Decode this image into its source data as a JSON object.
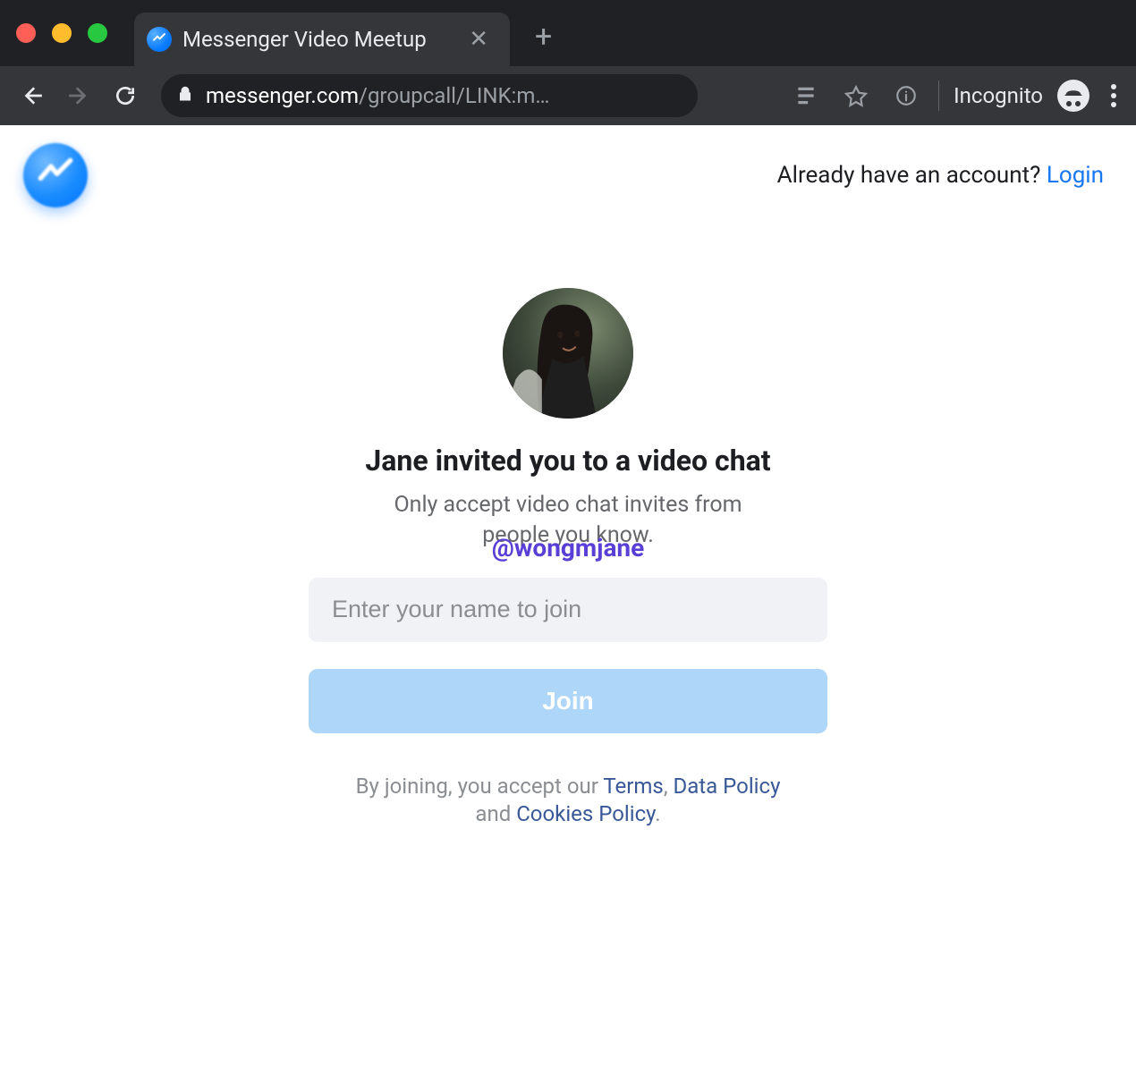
{
  "browser": {
    "tab_title": "Messenger Video Meetup",
    "url_host": "messenger.com",
    "url_path": "/groupcall/LINK:m…",
    "incognito_label": "Incognito"
  },
  "header": {
    "already_have": "Already have an account? ",
    "login": "Login"
  },
  "main": {
    "invite_heading": "Jane invited you to a video chat",
    "subtext": "Only accept video chat invites from people you know.",
    "watermark": "@wongmjane",
    "name_placeholder": "Enter your name to join",
    "join_label": "Join"
  },
  "legal": {
    "prefix": "By joining, you accept our ",
    "terms": "Terms",
    "sep1": ", ",
    "data_policy": "Data Policy",
    "sep2": " and ",
    "cookies": "Cookies Policy",
    "suffix": "."
  }
}
